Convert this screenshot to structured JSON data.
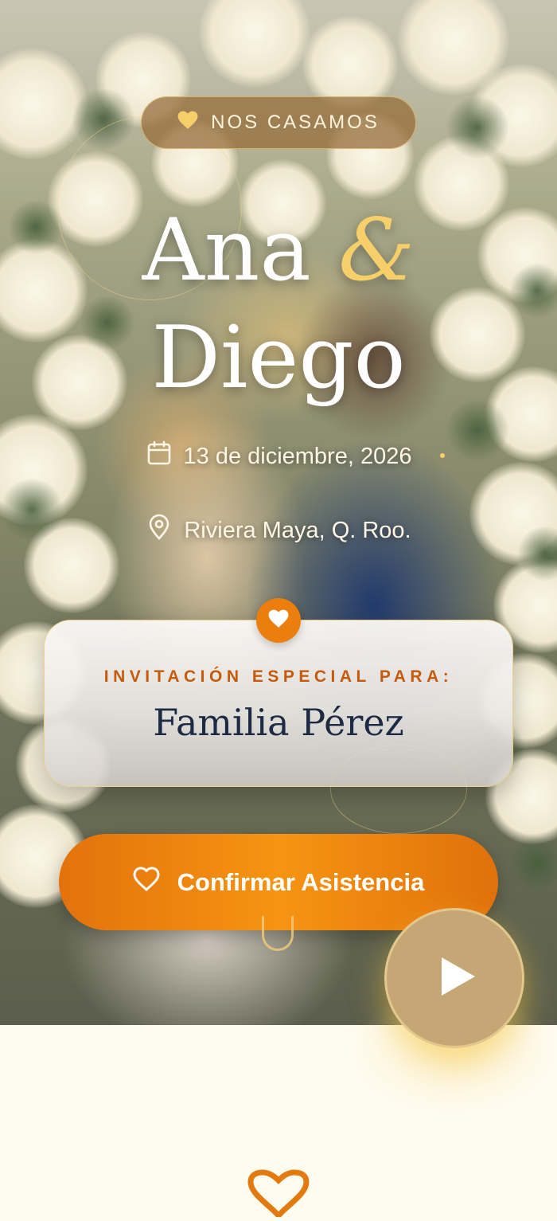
{
  "hero": {
    "badge_icon": "heart-icon",
    "badge_text": "NOS CASAMOS",
    "name_first": "Ana",
    "ampersand": "&",
    "name_second": "Diego",
    "date_icon": "calendar-icon",
    "date_text": "13 de diciembre, 2026",
    "location_icon": "location-pin-icon",
    "location_text": "Riviera Maya, Q. Roo."
  },
  "invitation": {
    "icon": "heart-icon",
    "label": "INVITACIÓN ESPECIAL PARA:",
    "guest": "Familia Pérez"
  },
  "rsvp": {
    "icon": "heart-outline-icon",
    "label": "Confirmar Asistencia"
  },
  "music": {
    "icon": "play-icon"
  },
  "colors": {
    "accent": "#ec7e0d",
    "gold": "#f6cf6a",
    "navy": "#1d2a44",
    "cream": "#fefbef"
  }
}
